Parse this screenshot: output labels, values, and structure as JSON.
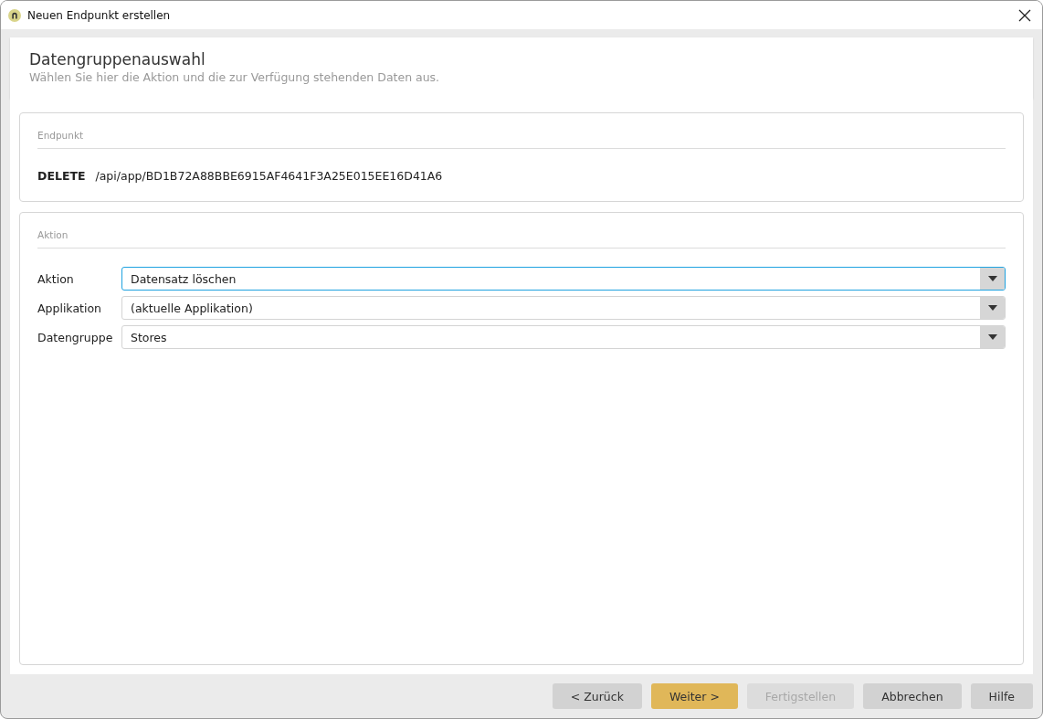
{
  "window": {
    "title": "Neuen Endpunkt erstellen"
  },
  "header": {
    "title": "Datengruppenauswahl",
    "subtitle": "Wählen Sie hier die Aktion und die zur Verfügung stehenden Daten aus."
  },
  "endpoint_section": {
    "heading": "Endpunkt",
    "method": "DELETE",
    "path": "/api/app/BD1B72A88BBE6915AF4641F3A25E015EE16D41A6"
  },
  "action_section": {
    "heading": "Aktion",
    "fields": [
      {
        "label": "Aktion",
        "value": "Datensatz löschen",
        "focused": true
      },
      {
        "label": "Applikation",
        "value": "(aktuelle Applikation)",
        "focused": false
      },
      {
        "label": "Datengruppe",
        "value": "Stores",
        "focused": false
      }
    ]
  },
  "buttons": [
    {
      "label": "< Zurück",
      "kind": "normal"
    },
    {
      "label": "Weiter >",
      "kind": "primary"
    },
    {
      "label": "Fertigstellen",
      "kind": "disabled"
    },
    {
      "label": "Abbrechen",
      "kind": "normal"
    },
    {
      "label": "Hilfe",
      "kind": "normal"
    }
  ]
}
